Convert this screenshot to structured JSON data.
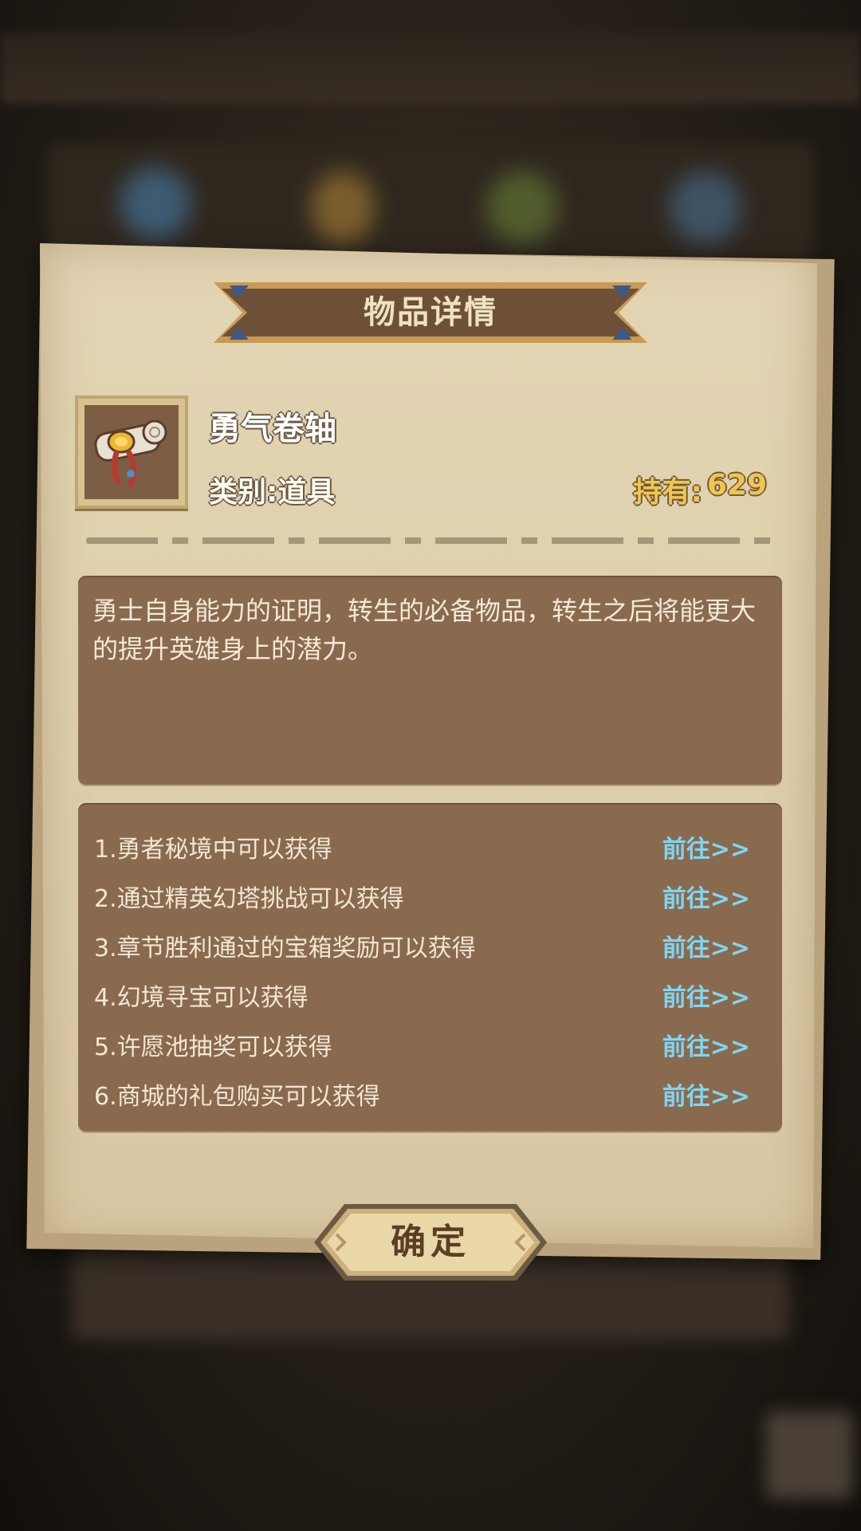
{
  "dialog": {
    "title": "物品详情"
  },
  "item": {
    "name": "勇气卷轴",
    "icon": "scroll-icon",
    "category": "类别:道具",
    "owned_label": "持有:",
    "owned_count": "629",
    "description": "勇士自身能力的证明，转生的必备物品，转生之后将能更大的提升英雄身上的潜力。"
  },
  "sources": [
    {
      "text": "1.勇者秘境中可以获得",
      "link": "前往>>"
    },
    {
      "text": "2.通过精英幻塔挑战可以获得",
      "link": "前往>>"
    },
    {
      "text": "3.章节胜利通过的宝箱奖励可以获得",
      "link": "前往>>"
    },
    {
      "text": "4.幻境寻宝可以获得",
      "link": "前往>>"
    },
    {
      "text": "5.许愿池抽奖可以获得",
      "link": "前往>>"
    },
    {
      "text": "6.商城的礼包购买可以获得",
      "link": "前往>>"
    }
  ],
  "confirm_label": "确定",
  "colors": {
    "paper": "#decfac",
    "panel": "#8a6a4f",
    "owned": "#f3c64a",
    "link": "#7fd6f2",
    "ribbon": "#6e5038"
  }
}
